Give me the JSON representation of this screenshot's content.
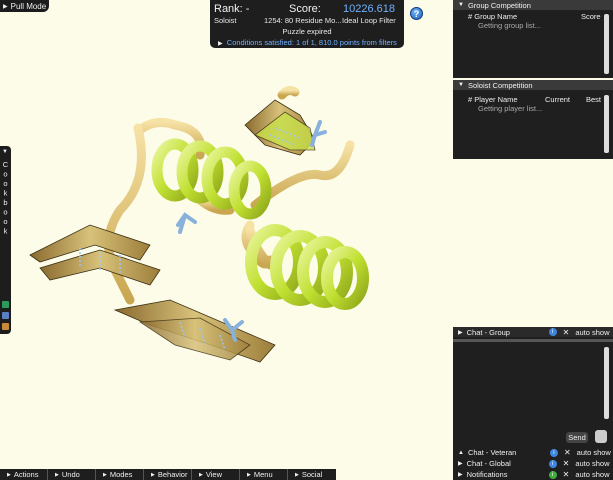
{
  "pull_mode": "Pull Mode",
  "score_panel": {
    "rank_label": "Rank: -",
    "score_label": "Score:",
    "score_value": "10226.618",
    "mode": "Soloist",
    "puzzle_name": "1254: 80 Residue Mo...",
    "filter_name": "Ideal Loop Filter",
    "status": "Puzzle expired",
    "conditions": "Conditions satisfied: 1 of 1, 810.0 points from filters"
  },
  "help_label": "?",
  "group_competition": {
    "title": "Group Competition",
    "col_group": "# Group Name",
    "col_score": "Score",
    "message": "Getting group list..."
  },
  "soloist_competition": {
    "title": "Soloist Competition",
    "col_player": "# Player Name",
    "col_current": "Current",
    "col_best": "Best",
    "message": "Getting player list..."
  },
  "cookbook_label": "Cookbook",
  "chats": {
    "group": "Chat - Group",
    "veteran": "Chat - Veteran",
    "global": "Chat - Global",
    "notifications": "Notifications",
    "auto_show": "auto show",
    "close": "✕",
    "info": "i",
    "send": "Send"
  },
  "toolbar": [
    {
      "label": "Actions"
    },
    {
      "label": "Undo"
    },
    {
      "label": "Modes"
    },
    {
      "label": "Behavior"
    },
    {
      "label": "View"
    },
    {
      "label": "Menu"
    },
    {
      "label": "Social"
    }
  ],
  "colors": {
    "background": "#fcfce9",
    "panel": "#1f1f1f",
    "accent_blue": "#6fb2ff",
    "helix": "#b9e02a",
    "sheet": "#c7a85a",
    "loop": "#eac77a",
    "sidechain": "#8ab6e0"
  },
  "icons": [
    "help-icon",
    "triangle-icon",
    "info-icon",
    "close-icon",
    "clock-icon"
  ]
}
